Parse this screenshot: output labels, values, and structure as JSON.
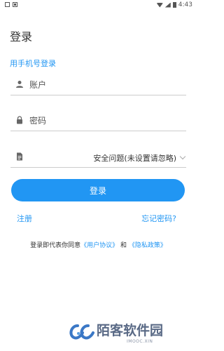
{
  "status_bar": {
    "time": "4:43"
  },
  "title": "登录",
  "login_mode_link": "用手机号登录",
  "account_field": {
    "placeholder": "账户",
    "value": ""
  },
  "password_field": {
    "placeholder": "密码",
    "value": ""
  },
  "security_question": {
    "selected": "安全问题(未设置请忽略)"
  },
  "login_button": "登录",
  "register_link": "注册",
  "forgot_link": "忘记密码?",
  "agreement": {
    "prefix": "登录即代表你同意",
    "user_agreement": "《用户协议》",
    "and": "和",
    "privacy_policy": "《隐私政策》"
  },
  "watermark": {
    "name": "陌客软件园",
    "sub": "IMOOC.XIN"
  },
  "colors": {
    "accent": "#2196f3"
  },
  "icons": {
    "account": "person-icon",
    "password": "lock-icon",
    "question": "document-icon"
  }
}
